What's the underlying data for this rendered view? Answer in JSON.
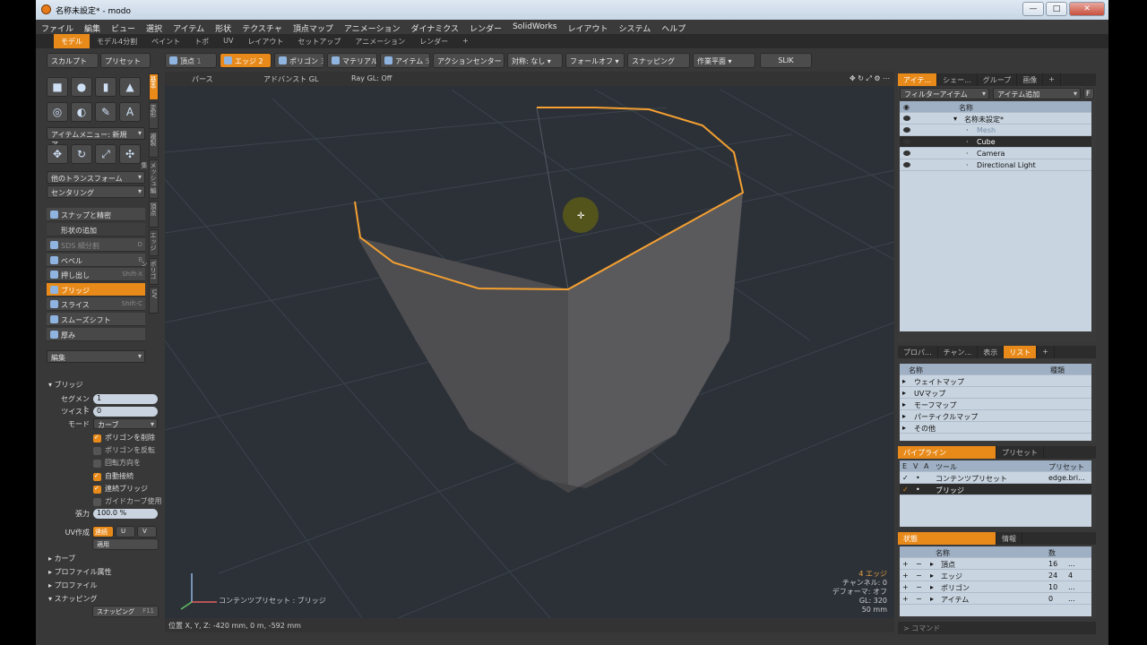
{
  "window": {
    "title": "名称未設定* - modo",
    "buttons": [
      "—",
      "□",
      "✕"
    ]
  },
  "menu": [
    "ファイル",
    "編集",
    "ビュー",
    "選択",
    "アイテム",
    "形状",
    "テクスチャ",
    "頂点マップ",
    "アニメーション",
    "ダイナミクス",
    "レンダー",
    "SolidWorks",
    "レイアウト",
    "システム",
    "ヘルプ"
  ],
  "layout_tabs": {
    "active": "モデル",
    "others": [
      "モデル4分割",
      "ペイント",
      "トポ",
      "UV",
      "レイアウト",
      "セットアップ",
      "アニメーション",
      "レンダー",
      "+"
    ]
  },
  "toolbar": {
    "sculpt": "スカルプト",
    "preset": "プリセット",
    "vertex": "頂点",
    "edge": "エッジ",
    "polygon": "ポリゴン",
    "material": "マテリアル",
    "item": "アイテム",
    "action_center": "アクションセンター",
    "symmetry": "対称: なし",
    "falloff": "フォールオフ",
    "snapping": "スナッピング",
    "work_plane": "作業平面",
    "slik": "SLIK",
    "key_vertex": "1",
    "key_edge": "2",
    "key_polygon": "3",
    "key_item": "5"
  },
  "left": {
    "item_menu": "アイテムメニュー: 新規ア...",
    "other_transform": "他のトランスフォーム",
    "centering": "センタリング",
    "snap_precise": "スナップと精密",
    "add_shape": "形状の追加",
    "tools": [
      {
        "label": "SDS 細分割",
        "shortcut": "D",
        "state": "dim"
      },
      {
        "label": "ベベル",
        "shortcut": "B",
        "state": "normal"
      },
      {
        "label": "押し出し",
        "shortcut": "Shift-X",
        "state": "normal"
      },
      {
        "label": "ブリッジ",
        "shortcut": "",
        "state": "sel"
      },
      {
        "label": "スライス",
        "shortcut": "Shift-C",
        "state": "normal"
      },
      {
        "label": "スムーズシフト",
        "shortcut": "",
        "state": "normal"
      },
      {
        "label": "厚み",
        "shortcut": "",
        "state": "normal"
      }
    ],
    "edit": "編集",
    "vtabs": [
      "基本",
      "変形",
      "複製",
      "メッシュ編集",
      "頂点",
      "エッジ",
      "ポリゴン",
      "UV"
    ]
  },
  "props": {
    "section": "ブリッジ",
    "segments_label": "セグメント",
    "segments": "1",
    "twist_label": "ツイスト",
    "twist": "0",
    "mode_label": "モード",
    "mode": "カーブ",
    "checks": [
      {
        "label": "ポリゴンを削除",
        "on": true
      },
      {
        "label": "ポリゴンを反転",
        "on": false
      },
      {
        "label": "回転方向を",
        "on": false
      },
      {
        "label": "自動接続",
        "on": true
      },
      {
        "label": "連続ブリッジ",
        "on": true
      },
      {
        "label": "ガイドカーブ使用",
        "on": false
      }
    ],
    "tension_label": "張力",
    "tension": "100.0 %",
    "uv_label": "UV作成",
    "uv_opts": [
      "連続",
      "U",
      "V"
    ],
    "apply": "適用",
    "groups": [
      "カーブ",
      "プロファイル属性",
      "プロファイル",
      "スナッピング"
    ],
    "snapping_btn": "スナッピング",
    "snapping_key": "F11"
  },
  "viewport": {
    "tabs": [
      "パース",
      "アドバンスト GL",
      "Ray GL: Off"
    ],
    "info": {
      "edges": "4 エッジ",
      "channel": "チャンネル: 0",
      "deform": "デフォーマ: オフ",
      "gl": "GL: 320",
      "unit": "50 mm"
    },
    "preset_label": "コンテンツプリセット : ブリッジ",
    "position": "位置 X, Y, Z:   -420 mm, 0 m, -592 mm"
  },
  "item_panel": {
    "tabs": [
      "アイテ...",
      "シェー...",
      "グループ",
      "画像",
      "+"
    ],
    "filter": "フィルターアイテム",
    "add": "アイテム追加",
    "f": "F",
    "name_header": "名称",
    "rows": [
      {
        "label": "名称未設定*",
        "indent": 0,
        "sel": false
      },
      {
        "label": "Mesh",
        "indent": 1,
        "sel": false
      },
      {
        "label": "Cube",
        "indent": 1,
        "sel": true
      },
      {
        "label": "Camera",
        "indent": 1,
        "sel": false
      },
      {
        "label": "Directional Light",
        "indent": 1,
        "sel": false
      }
    ]
  },
  "list_panel": {
    "tabs": [
      "プロパ...",
      "チャン...",
      "表示",
      "リスト",
      "+"
    ],
    "name_header": "名称",
    "type_header": "種類",
    "rows": [
      "ウェイトマップ",
      "UVマップ",
      "モーフマップ",
      "パーティクルマップ",
      "その他"
    ]
  },
  "pipeline": {
    "tabs": [
      "パイプライン",
      "プリセット"
    ],
    "cols": [
      "E",
      "V",
      "A",
      "ツール",
      "プリセット"
    ],
    "rows": [
      {
        "tool": "コンテンツプリセット",
        "preset": "edge.bri...",
        "sel": false
      },
      {
        "tool": "ブリッジ",
        "preset": "",
        "sel": true
      }
    ]
  },
  "stats": {
    "tabs": [
      "状態",
      "情報"
    ],
    "name_header": "名称",
    "count_header": "数",
    "rows": [
      {
        "label": "頂点",
        "count": "16",
        "extra": "..."
      },
      {
        "label": "エッジ",
        "count": "24",
        "extra": "4"
      },
      {
        "label": "ポリゴン",
        "count": "10",
        "extra": "..."
      },
      {
        "label": "アイテム",
        "count": "0",
        "extra": "..."
      }
    ]
  },
  "command": "コマンド",
  "colors": {
    "accent": "#e88a1a",
    "viewport": "#2c3138",
    "panel": "#383838",
    "edge_highlight": "#f5a030"
  }
}
